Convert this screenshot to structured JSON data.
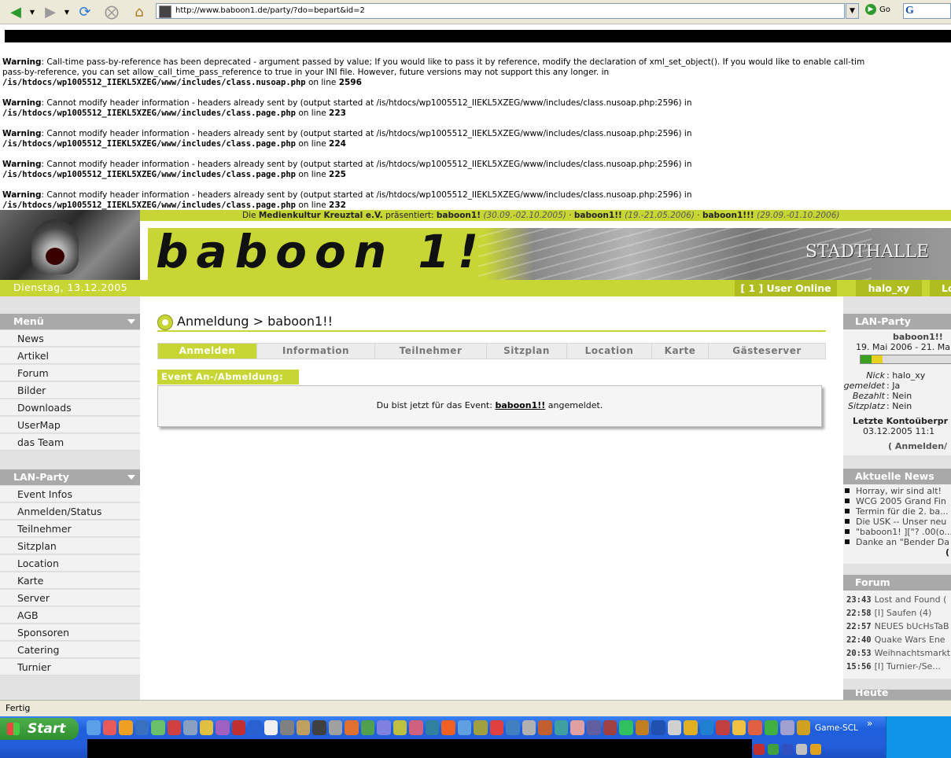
{
  "browser": {
    "url": "http://www.baboon1.de/party/?do=bepart&id=2",
    "go_label": "Go",
    "google_label": "G",
    "status": "Fertig"
  },
  "warnings": [
    {
      "label": "Warning",
      "text": ": Call-time pass-by-reference has been deprecated - argument passed by value; If you would like to pass it by reference, modify the declaration of xml_set_object(). If you would like to enable call-tim",
      "text2": "pass-by-reference, you can set allow_call_time_pass_reference to true in your INI file. However, future versions may not support this any longer. in",
      "path": "/is/htdocs/wp1005512_IIEKL5XZEG/www/includes/class.nusoap.php",
      "line": "2596"
    },
    {
      "label": "Warning",
      "text": ": Cannot modify header information - headers already sent by (output started at /is/htdocs/wp1005512_IIEKL5XZEG/www/includes/class.nusoap.php:2596) in",
      "path": "/is/htdocs/wp1005512_IIEKL5XZEG/www/includes/class.page.php",
      "line": "223"
    },
    {
      "label": "Warning",
      "text": ": Cannot modify header information - headers already sent by (output started at /is/htdocs/wp1005512_IIEKL5XZEG/www/includes/class.nusoap.php:2596) in",
      "path": "/is/htdocs/wp1005512_IIEKL5XZEG/www/includes/class.page.php",
      "line": "224"
    },
    {
      "label": "Warning",
      "text": ": Cannot modify header information - headers already sent by (output started at /is/htdocs/wp1005512_IIEKL5XZEG/www/includes/class.nusoap.php:2596) in",
      "path": "/is/htdocs/wp1005512_IIEKL5XZEG/www/includes/class.page.php",
      "line": "225"
    },
    {
      "label": "Warning",
      "text": ": Cannot modify header information - headers already sent by (output started at /is/htdocs/wp1005512_IIEKL5XZEG/www/includes/class.nusoap.php:2596) in",
      "path": "/is/htdocs/wp1005512_IIEKL5XZEG/www/includes/class.page.php",
      "line": "232"
    }
  ],
  "on_line": "on line",
  "header": {
    "strip_prefix": "Die",
    "org": "Medienkultur Kreuztal e.V.",
    "strip_mid": "präsentiert:",
    "events": [
      {
        "name": "baboon1!",
        "dates": "(30.09.-02.10.2005)"
      },
      {
        "name": "baboon1!!",
        "dates": "(19.-21.05.2006)"
      },
      {
        "name": "baboon1!!!",
        "dates": "(29.09.-01.10.2006)"
      }
    ],
    "logo": "baboon 1!",
    "stadthalle": "STADTHALLE",
    "date": "Dienstag, 13.12.2005",
    "users_online": "[ 1 ] User Online",
    "username": "halo_xy",
    "logout_partial": "Lo"
  },
  "left_menu": {
    "menu_title": "Menü",
    "menu_items": [
      "News",
      "Artikel",
      "Forum",
      "Bilder",
      "Downloads",
      "UserMap",
      "das Team"
    ],
    "lan_title": "LAN-Party",
    "lan_items": [
      "Event Infos",
      "Anmelden/Status",
      "Teilnehmer",
      "Sitzplan",
      "Location",
      "Karte",
      "Server",
      "AGB",
      "Sponsoren",
      "Catering",
      "Turnier"
    ]
  },
  "main": {
    "title": "Anmeldung > baboon1!!",
    "tabs": [
      "Anmelden",
      "Information",
      "Teilnehmer",
      "Sitzplan",
      "Location",
      "Karte",
      "Gästeserver"
    ],
    "box_label": "Event An-/Abmeldung:",
    "msg_prefix": "Du bist jetzt für das Event:",
    "msg_event": "baboon1!!",
    "msg_suffix": "angemeldet."
  },
  "right": {
    "lan_title": "LAN-Party",
    "event_name": "baboon1!!",
    "event_dates": "19. Mai 2006 - 21. Ma",
    "nick_label": "Nick",
    "nick_value": ": halo_xy",
    "angemeldet_label": "Angemeldet",
    "angemeldet_value": ": Ja",
    "bezahlt_label": "Bezahlt",
    "bezahlt_value": ": Nein",
    "sitzplatz_label": "Sitzplatz",
    "sitzplatz_value": ": Nein",
    "konto_label": "Letzte Kontoüberpr",
    "konto_date": "03.12.2005 11:1",
    "anmelden_link": "( Anmelden/",
    "news_title": "Aktuelle News",
    "news_items": [
      "Horray, wir sind alt!",
      "WCG 2005 Grand Fin",
      "Termin für die 2. ba...",
      "Die USK -- Unser neu",
      "\"baboon1! ][\"? .00(o...",
      "Danke an \"Bender Da"
    ],
    "news_more": "(",
    "forum_title": "Forum",
    "forum_items": [
      {
        "time": "23:43",
        "text": "Lost and Found ("
      },
      {
        "time": "22:58",
        "text": "[I] Saufen (4)"
      },
      {
        "time": "22:57",
        "text": "NEUES bUcHsTaB"
      },
      {
        "time": "22:40",
        "text": "Quake Wars Ene"
      },
      {
        "time": "20:53",
        "text": "Weihnachtsmarkt"
      },
      {
        "time": "15:56",
        "text": "[I] Turnier-/Se..."
      }
    ],
    "birthdays_partial": "Heute Geburtstag"
  },
  "taskbar": {
    "start": "Start",
    "game_label": "Game-SCL",
    "chevron": "»"
  }
}
